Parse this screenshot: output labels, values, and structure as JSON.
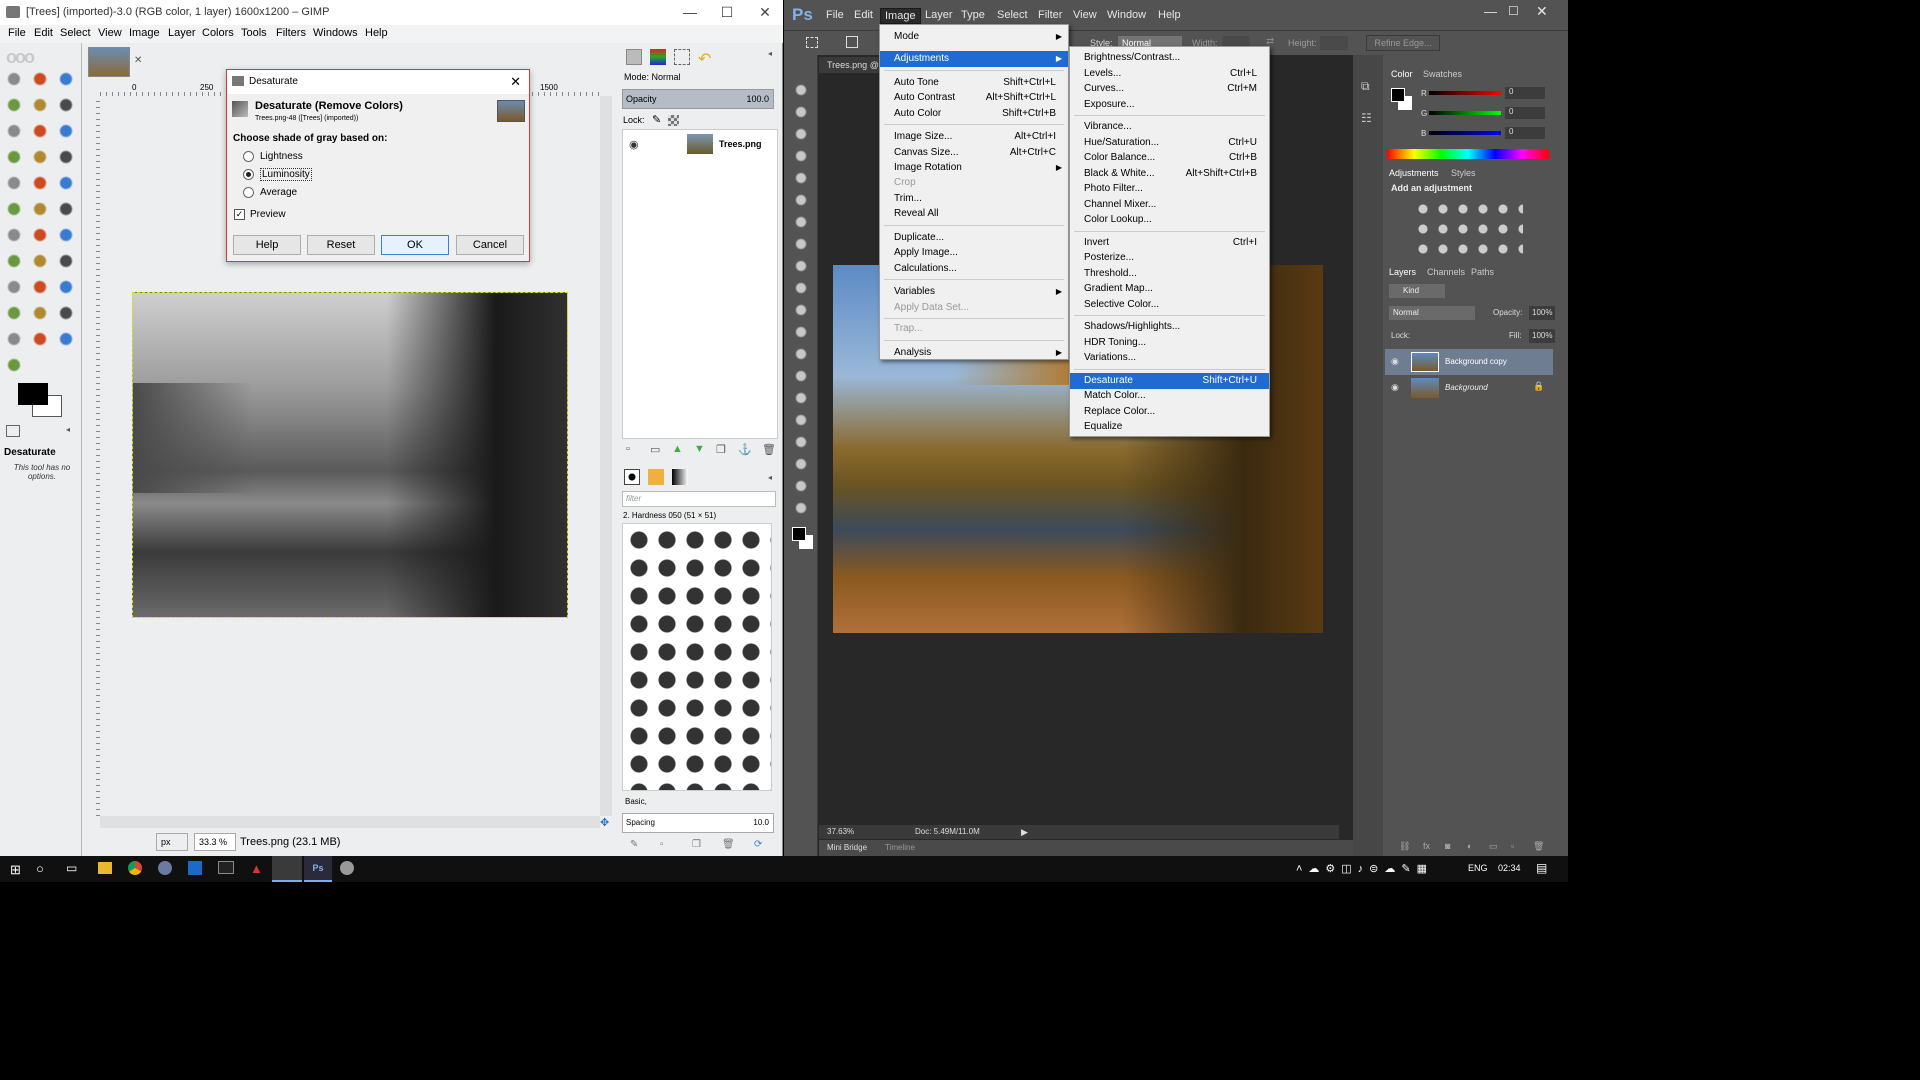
{
  "gimp": {
    "title": "[Trees] (imported)-3.0 (RGB color, 1 layer) 1600x1200 – GIMP",
    "menu": [
      "File",
      "Edit",
      "Select",
      "View",
      "Image",
      "Layer",
      "Colors",
      "Tools",
      "Filters",
      "Windows",
      "Help"
    ],
    "tool_options_title": "Desaturate",
    "tool_options_note": "This tool has no options.",
    "ruler_labels": [
      "0",
      "250",
      "1500"
    ],
    "zoom": "33.3 %",
    "unit": "px",
    "status": "Trees.png (23.1 MB)",
    "layers": {
      "mode_label": "Mode: Normal",
      "opacity_label": "Opacity",
      "opacity_value": "100.0",
      "lock_label": "Lock:",
      "layer_name": "Trees.png"
    },
    "brushes": {
      "filter_placeholder": "filter",
      "brush_name": "2. Hardness 050 (51 × 51)",
      "preset": "Basic,",
      "spacing_label": "Spacing",
      "spacing_value": "10.0"
    },
    "dialog": {
      "title": "Desaturate",
      "heading": "Desaturate (Remove Colors)",
      "subheading": "Trees.png-48 ([Trees] (imported))",
      "choose_label": "Choose shade of gray based on:",
      "options": [
        "Lightness",
        "Luminosity",
        "Average"
      ],
      "selected": "Luminosity",
      "preview_label": "Preview",
      "preview_checked": true,
      "buttons": {
        "help": "Help",
        "reset": "Reset",
        "ok": "OK",
        "cancel": "Cancel"
      }
    }
  },
  "ps": {
    "logo": "Ps",
    "menu": [
      "File",
      "Edit",
      "Image",
      "Layer",
      "Type",
      "Select",
      "Filter",
      "View",
      "Window",
      "Help"
    ],
    "options": {
      "style_label": "Style:",
      "style_value": "Normal",
      "width_label": "Width:",
      "height_label": "Height:",
      "refine": "Refine Edge..."
    },
    "doc_tab": "Trees.png @",
    "status": {
      "zoom": "37.63%",
      "doc": "Doc: 5.49M/11.0M"
    },
    "bottom_tabs": [
      "Mini Bridge",
      "Timeline"
    ],
    "image_menu": [
      {
        "label": "Mode",
        "sub": true
      },
      {
        "label": "Adjustments",
        "sub": true,
        "highlight": true
      },
      {
        "label": "Auto Tone",
        "shortcut": "Shift+Ctrl+L"
      },
      {
        "label": "Auto Contrast",
        "shortcut": "Alt+Shift+Ctrl+L"
      },
      {
        "label": "Auto Color",
        "shortcut": "Shift+Ctrl+B"
      },
      {
        "label": "Image Size...",
        "shortcut": "Alt+Ctrl+I"
      },
      {
        "label": "Canvas Size...",
        "shortcut": "Alt+Ctrl+C"
      },
      {
        "label": "Image Rotation",
        "sub": true
      },
      {
        "label": "Crop",
        "disabled": true
      },
      {
        "label": "Trim..."
      },
      {
        "label": "Reveal All"
      },
      {
        "label": "Duplicate..."
      },
      {
        "label": "Apply Image..."
      },
      {
        "label": "Calculations..."
      },
      {
        "label": "Variables",
        "sub": true
      },
      {
        "label": "Apply Data Set...",
        "disabled": true
      },
      {
        "label": "Trap...",
        "disabled": true
      },
      {
        "label": "Analysis",
        "sub": true
      }
    ],
    "adjust_menu": [
      {
        "label": "Brightness/Contrast..."
      },
      {
        "label": "Levels...",
        "shortcut": "Ctrl+L"
      },
      {
        "label": "Curves...",
        "shortcut": "Ctrl+M"
      },
      {
        "label": "Exposure..."
      },
      {
        "label": "Vibrance..."
      },
      {
        "label": "Hue/Saturation...",
        "shortcut": "Ctrl+U"
      },
      {
        "label": "Color Balance...",
        "shortcut": "Ctrl+B"
      },
      {
        "label": "Black & White...",
        "shortcut": "Alt+Shift+Ctrl+B"
      },
      {
        "label": "Photo Filter..."
      },
      {
        "label": "Channel Mixer..."
      },
      {
        "label": "Color Lookup..."
      },
      {
        "label": "Invert",
        "shortcut": "Ctrl+I"
      },
      {
        "label": "Posterize..."
      },
      {
        "label": "Threshold..."
      },
      {
        "label": "Gradient Map..."
      },
      {
        "label": "Selective Color..."
      },
      {
        "label": "Shadows/Highlights..."
      },
      {
        "label": "HDR Toning..."
      },
      {
        "label": "Variations..."
      },
      {
        "label": "Desaturate",
        "shortcut": "Shift+Ctrl+U",
        "highlight": true
      },
      {
        "label": "Match Color..."
      },
      {
        "label": "Replace Color..."
      },
      {
        "label": "Equalize"
      }
    ],
    "color_panel": {
      "tabs": [
        "Color",
        "Swatches"
      ],
      "channels": [
        {
          "name": "R",
          "value": "0"
        },
        {
          "name": "G",
          "value": "0"
        },
        {
          "name": "B",
          "value": "0"
        }
      ]
    },
    "adjust_panel": {
      "tabs": [
        "Adjustments",
        "Styles"
      ],
      "title": "Add an adjustment"
    },
    "layers_panel": {
      "tabs": [
        "Layers",
        "Channels",
        "Paths"
      ],
      "kind": "Kind",
      "blend": "Normal",
      "opacity_label": "Opacity:",
      "opacity_value": "100%",
      "lock_label": "Lock:",
      "fill_label": "Fill:",
      "fill_value": "100%",
      "layers": [
        {
          "name": "Background copy",
          "selected": true
        },
        {
          "name": "Background",
          "selected": false
        }
      ]
    }
  },
  "taskbar": {
    "lang": "ENG",
    "time": "02:34"
  }
}
